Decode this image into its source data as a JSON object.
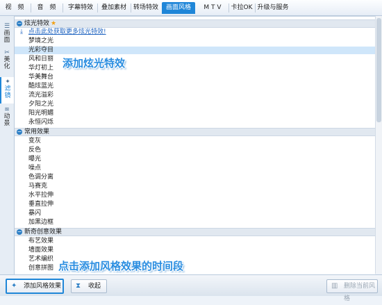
{
  "tabs": [
    "视　频",
    "音　频",
    "字幕特效",
    "叠加素材",
    "转场特效",
    "画面风格",
    "M T V",
    "卡拉OK",
    "升级与服务"
  ],
  "active_tab": "画面风格",
  "sidebar": [
    {
      "label": "画面",
      "icon": "filter-list-icon"
    },
    {
      "label": "美化",
      "icon": "tools-icon"
    },
    {
      "label": "滤镜",
      "icon": "magic-wand-icon"
    },
    {
      "label": "动景",
      "icon": "wave-icon"
    }
  ],
  "groups": [
    {
      "title": "炫光特效",
      "star": "★",
      "link": "点击此处获取更多炫光特效!",
      "items": [
        "梦境之光",
        "光彩夺目",
        "风和日丽",
        "华灯初上",
        "华美舞台",
        "酷炫蓝光",
        "流光溢彩",
        "夕阳之光",
        "阳光明媚",
        "永恒闪烁"
      ]
    },
    {
      "title": "常用效果",
      "items": [
        "变灰",
        "反色",
        "曝光",
        "噪点",
        "色调分离",
        "马赛克",
        "水平拉伸",
        "垂直拉伸",
        "暴闪",
        "加黑边框"
      ]
    },
    {
      "title": "新奇创意效果",
      "items": [
        "布艺效果",
        "墙面效果",
        "艺术编织",
        "创意拼图"
      ]
    }
  ],
  "selected_item": "光彩夺目",
  "annotations": {
    "top": "添加炫光特效",
    "bottom": "点击添加风格效果的时间段"
  },
  "buttons": {
    "add": "添加风格效果",
    "collapse": "收起",
    "delete": "删除当前风格"
  },
  "colors": {
    "accent": "#1f86d8",
    "selection": "#cfe6fa",
    "link": "#1e63c0",
    "star": "#f2a012"
  }
}
